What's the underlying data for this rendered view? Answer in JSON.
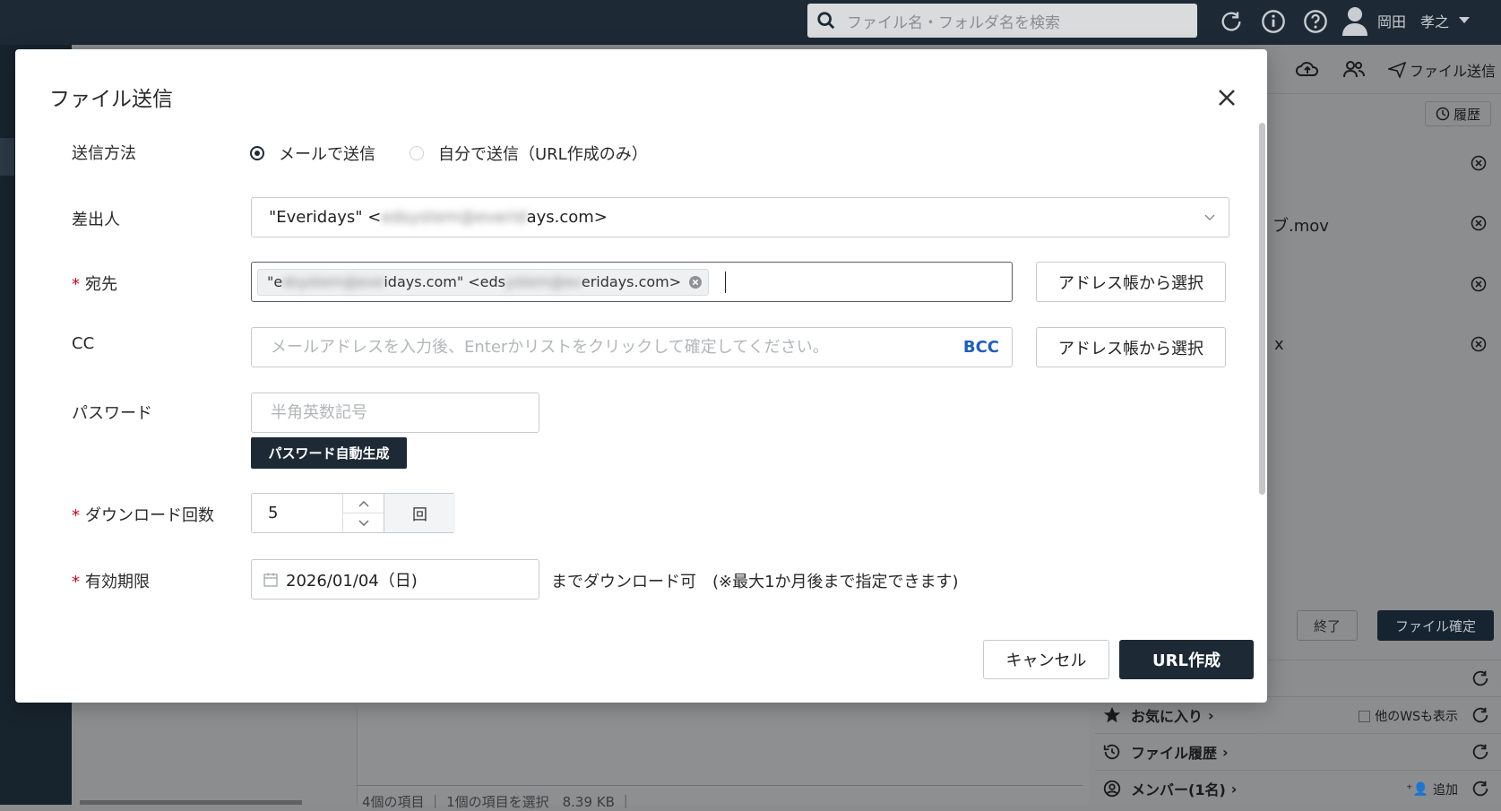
{
  "topbar": {
    "search_placeholder": "ファイル名・フォルダ名を検索",
    "user_name": "岡田　孝之"
  },
  "right_panel": {
    "send_label": "ファイル送信",
    "history_label": "履歴",
    "files": [
      "ブ.mov",
      "x"
    ],
    "end_label": "終了",
    "confirm_label": "ファイル確定",
    "favorites_label": "お気に入り",
    "show_other_ws_label": "他のWSも表示",
    "file_history_label": "ファイル履歴",
    "members_label": "メンバー(1名)",
    "add_label": "追加"
  },
  "status_bar": {
    "text": "4個の項目 ｜ 1個の項目を選択　8.39 KB ｜"
  },
  "modal": {
    "title": "ファイル送信",
    "send_method": {
      "label": "送信方法",
      "options": [
        "メールで送信",
        "自分で送信（URL作成のみ）"
      ],
      "selected": "メールで送信"
    },
    "sender": {
      "label": "差出人",
      "value_prefix": "\"Everidays\" <",
      "value_hidden": "edsystem@everid",
      "value_suffix": "ays.com>"
    },
    "to": {
      "label": "宛先",
      "required_mark": "*",
      "chip_part1": "\"e",
      "chip_hidden1": "dsystem@eve",
      "chip_part2": "idays.com\" <eds",
      "chip_hidden2": "ystem@ev",
      "chip_part3": "eridays.com>"
    },
    "cc": {
      "label": "CC",
      "placeholder": "メールアドレスを入力後、Enterかリストをクリックして確定してください。",
      "bcc_label": "BCC"
    },
    "address_book_label": "アドレス帳から選択",
    "password": {
      "label": "パスワード",
      "placeholder": "半角英数記号",
      "generate_label": "パスワード自動生成"
    },
    "download_count": {
      "label": "ダウンロード回数",
      "required_mark": "*",
      "value": "5",
      "unit": "回"
    },
    "expiry": {
      "label": "有効期限",
      "required_mark": "*",
      "value": "2026/01/04（日)",
      "note": "までダウンロード可　(※最大1か月後まで指定できます)"
    },
    "cancel_label": "キャンセル",
    "create_label": "URL作成"
  }
}
